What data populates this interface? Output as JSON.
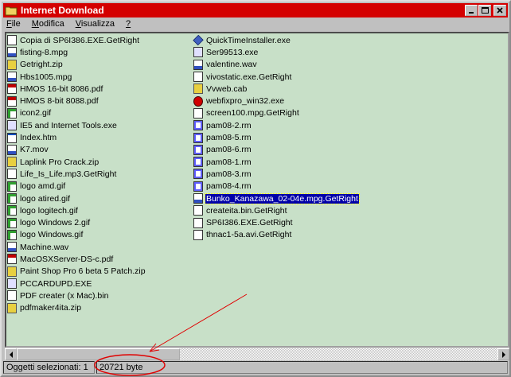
{
  "window": {
    "title": "Internet Download"
  },
  "menu": [
    {
      "underline": "F",
      "rest": "ile"
    },
    {
      "underline": "M",
      "rest": "odifica"
    },
    {
      "underline": "V",
      "rest": "isualizza"
    },
    {
      "underline": "?",
      "rest": ""
    }
  ],
  "files_col1": [
    {
      "name": "Copia di SP6I386.EXE.GetRight",
      "icon": "doc"
    },
    {
      "name": "fisting-8.mpg",
      "icon": "media"
    },
    {
      "name": "Getright.zip",
      "icon": "zip"
    },
    {
      "name": "Hbs1005.mpg",
      "icon": "media"
    },
    {
      "name": "HMOS 16-bit 8086.pdf",
      "icon": "pdf"
    },
    {
      "name": "HMOS 8-bit 8088.pdf",
      "icon": "pdf"
    },
    {
      "name": "icon2.gif",
      "icon": "gif"
    },
    {
      "name": "IE5 and Internet Tools.exe",
      "icon": "exe"
    },
    {
      "name": "Index.htm",
      "icon": "browser"
    },
    {
      "name": "K7.mov",
      "icon": "media"
    },
    {
      "name": "Laplink Pro Crack.zip",
      "icon": "zip"
    },
    {
      "name": "Life_Is_Life.mp3.GetRight",
      "icon": "doc"
    },
    {
      "name": "logo amd.gif",
      "icon": "gif"
    },
    {
      "name": "logo atired.gif",
      "icon": "gif"
    },
    {
      "name": "logo logitech.gif",
      "icon": "gif"
    },
    {
      "name": "logo Windows 2.gif",
      "icon": "gif"
    },
    {
      "name": "logo Windows.gif",
      "icon": "gif"
    },
    {
      "name": "Machine.wav",
      "icon": "media"
    },
    {
      "name": "MacOSXServer-DS-c.pdf",
      "icon": "pdf"
    },
    {
      "name": "Paint Shop Pro 6 beta 5 Patch.zip",
      "icon": "zip"
    },
    {
      "name": "PCCARDUPD.EXE",
      "icon": "exe"
    },
    {
      "name": "PDF creater (x Mac).bin",
      "icon": "doc"
    },
    {
      "name": "pdfmaker4ita.zip",
      "icon": "zip"
    }
  ],
  "files_col2": [
    {
      "name": "QuickTimeInstaller.exe",
      "icon": "diamond"
    },
    {
      "name": "Ser99513.exe",
      "icon": "exe"
    },
    {
      "name": "valentine.wav",
      "icon": "media"
    },
    {
      "name": "vivostatic.exe.GetRight",
      "icon": "doc"
    },
    {
      "name": "Vvweb.cab",
      "icon": "zip"
    },
    {
      "name": "webfixpro_win32.exe",
      "icon": "red"
    },
    {
      "name": "screen100.mpg.GetRight",
      "icon": "doc"
    },
    {
      "name": "pam08-2.rm",
      "icon": "rm"
    },
    {
      "name": "pam08-5.rm",
      "icon": "rm"
    },
    {
      "name": "pam08-6.rm",
      "icon": "rm"
    },
    {
      "name": "pam08-1.rm",
      "icon": "rm"
    },
    {
      "name": "pam08-3.rm",
      "icon": "rm"
    },
    {
      "name": "pam08-4.rm",
      "icon": "rm"
    },
    {
      "name": "Bunko_Kanazawa_02-04e.mpg.GetRight",
      "icon": "media",
      "selected": true
    },
    {
      "name": "createita.bin.GetRight",
      "icon": "doc"
    },
    {
      "name": "SP6I386.EXE.GetRight",
      "icon": "doc"
    },
    {
      "name": "thnac1-5a.avi.GetRight",
      "icon": "doc"
    }
  ],
  "status": {
    "selected": "Oggetti selezionati: 1",
    "size": "20721 byte"
  },
  "colors": {
    "titlebar": "#d40000",
    "list_background": "#c8e0c8",
    "selection": "#0000a8",
    "annotation": "#e00000"
  }
}
